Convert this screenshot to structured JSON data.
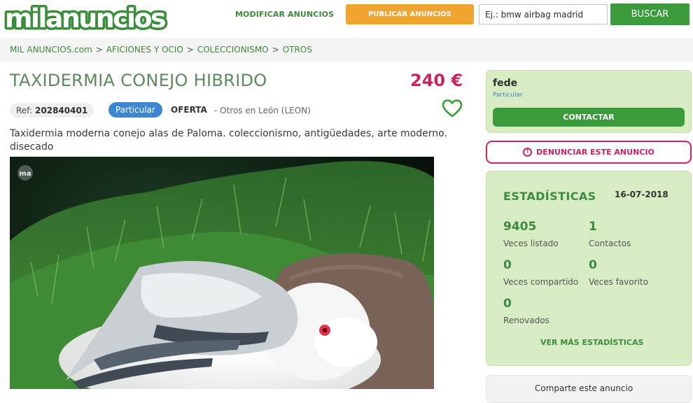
{
  "header": {
    "logo_text": "milanuncios",
    "modify_link": "MODIFICAR ANUNCIOS",
    "publish_button": "PUBLICAR ANUNCIOS",
    "search_placeholder": "Ej.: bmw airbag madrid",
    "search_button": "BUSCAR"
  },
  "breadcrumb": [
    "MIL ANUNCIOS.com",
    "AFICIONES Y OCIO",
    "COLECCIONISMO",
    "OTROS"
  ],
  "breadcrumb_separator": ">",
  "listing": {
    "title": "TAXIDERMIA CONEJO HIBRIDO",
    "price": "240 €",
    "ref_label": "Ref:",
    "ref_number": "202840401",
    "seller_badge": "Particular",
    "offer_type": "OFERTA",
    "location": "- Otros en León (LEON)",
    "description": "Taxidermia moderna conejo alas de Paloma. coleccionismo, antigüedades, arte moderno. disecado",
    "photo_watermark": "ma",
    "favorite_icon": "heart-icon"
  },
  "seller": {
    "name": "fede",
    "type": "Particular",
    "contact_button": "CONTACTAR"
  },
  "report_button": "DENUNCIAR ESTE ANUNCIO",
  "stats": {
    "title": "ESTADÍSTICAS",
    "date": "16-07-2018",
    "items": [
      {
        "value": "9405",
        "label": "Veces listado"
      },
      {
        "value": "1",
        "label": "Contactos"
      },
      {
        "value": "0",
        "label": "Veces compartido"
      },
      {
        "value": "0",
        "label": "Veces favorito"
      },
      {
        "value": "0",
        "label": "Renovados"
      }
    ],
    "more_link": "VER MÁS ESTADÍSTICAS"
  },
  "share": {
    "label": "Comparte este anuncio"
  },
  "colors": {
    "brand_green": "#3a9a3c",
    "accent_orange": "#f1a531",
    "price_pink": "#c9245c",
    "panel_green": "#d7ecc2"
  }
}
